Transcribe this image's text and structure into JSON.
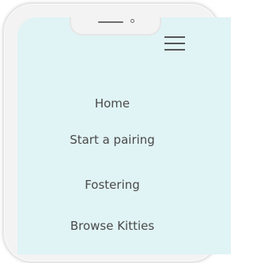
{
  "nav": {
    "menu_icon": "hamburger-menu-icon",
    "items": [
      {
        "label": "Home"
      },
      {
        "label": "Start a pairing"
      },
      {
        "label": "Fostering"
      },
      {
        "label": "Browse Kitties"
      }
    ]
  },
  "colors": {
    "screen_bg": "#e0f3f5",
    "frame": "#f3f3f3",
    "text": "#4a4a4a"
  }
}
